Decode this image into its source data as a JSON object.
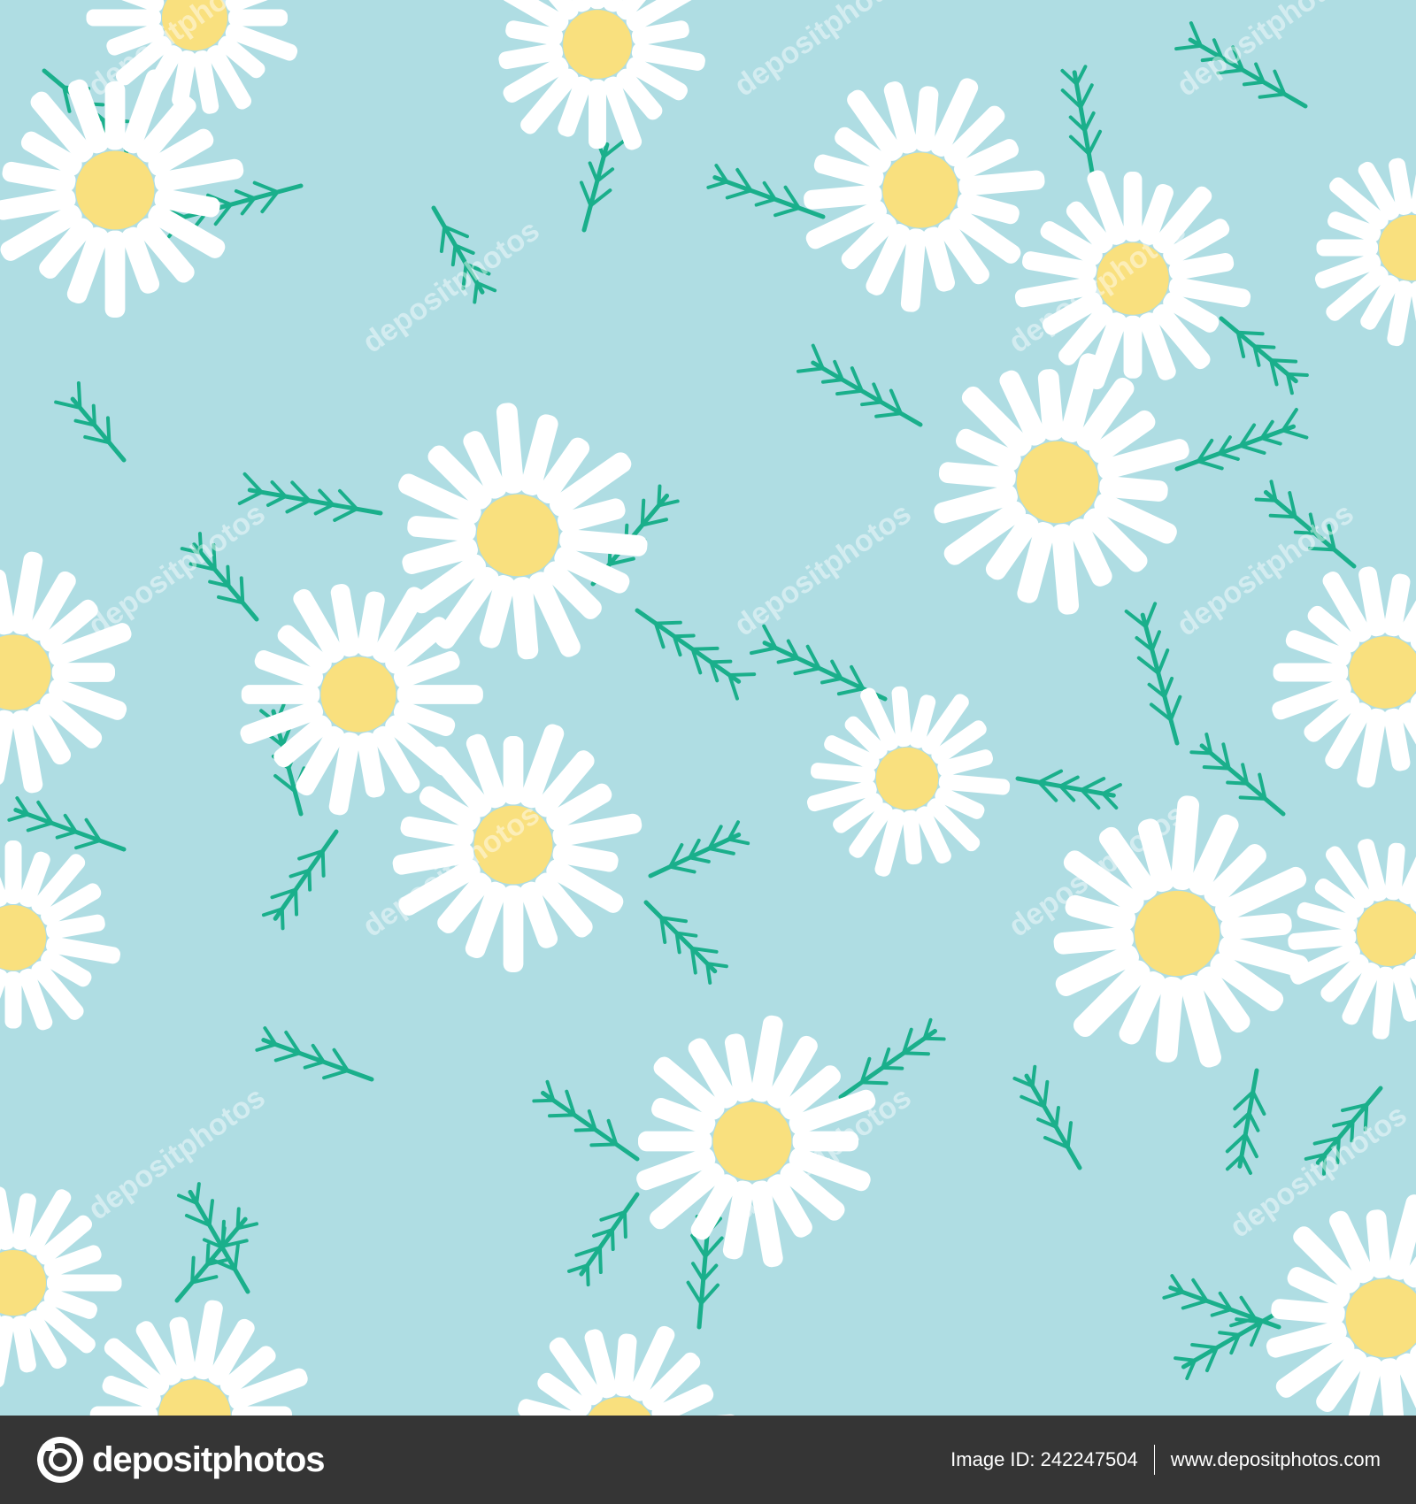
{
  "colors": {
    "background": "#afdde3",
    "petal": "#ffffff",
    "center": "#f9e07e",
    "leaf": "#1aaf8b",
    "footer_bg": "#353535",
    "footer_text": "#ffffff"
  },
  "footer": {
    "logo_icon": "camera-icon",
    "brand_name": "depositphotos",
    "image_id": "Image ID: 242247504",
    "site_url": "www.depositphotos.com"
  },
  "watermark": {
    "text": "depositphotos"
  }
}
